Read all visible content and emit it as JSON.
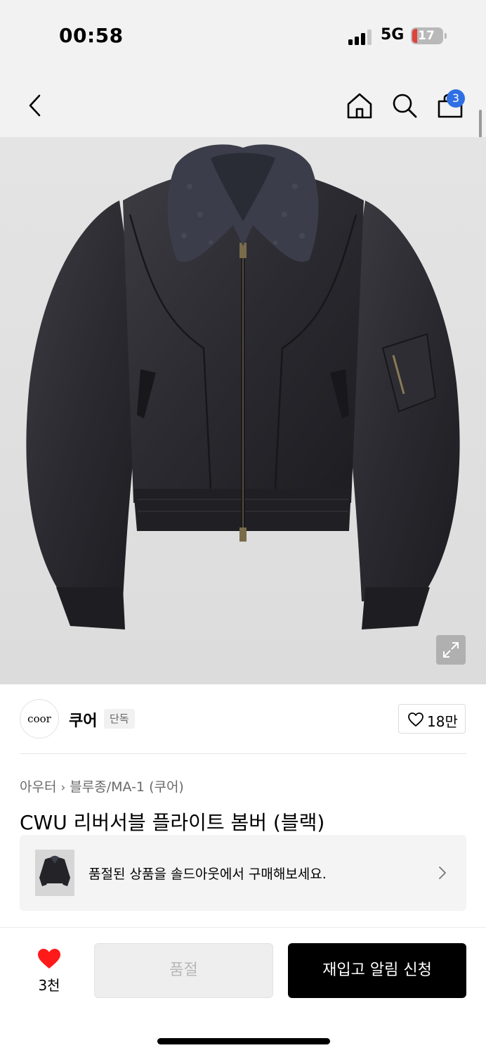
{
  "status_bar": {
    "time": "00:58",
    "network": "5G",
    "battery": "17",
    "battery_level_percent": 17,
    "battery_color": "#e0413a"
  },
  "nav": {
    "back_icon": "chevron-left-icon",
    "home_icon": "home-icon",
    "search_icon": "search-icon",
    "cart_icon": "shopping-bag-icon",
    "cart_count": "3",
    "badge_color": "#2f6fe4"
  },
  "product_image": {
    "expand_icon": "expand-icon"
  },
  "brand": {
    "logo_text": "coor",
    "name": "쿠어",
    "badge": "단독",
    "likes": "18만"
  },
  "breadcrumb": {
    "category": "아우터",
    "subcategory": "블루종/MA-1 (쿠어)"
  },
  "product": {
    "title": "CWU 리버서블 플라이트 봄버 (블랙)"
  },
  "soldout_banner": {
    "text": "품절된 상품을 솔드아웃에서 구매해보세요."
  },
  "bottom_bar": {
    "wish_count": "3천",
    "wish_color": "#ff1a1a",
    "soldout_label": "품절",
    "restock_label": "재입고 알림 신청"
  }
}
